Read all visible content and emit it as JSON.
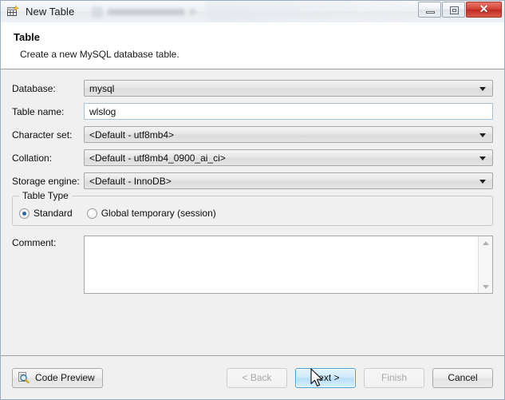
{
  "window": {
    "title": "New Table",
    "icon": "new-table-icon",
    "controls": {
      "minimize": "minimize-icon",
      "maximize": "restore-icon",
      "close": "✕"
    }
  },
  "header": {
    "title": "Table",
    "subtitle": "Create a new MySQL database table."
  },
  "form": {
    "database": {
      "label": "Database:",
      "value": "mysql",
      "type": "combobox"
    },
    "table_name": {
      "label": "Table name:",
      "value": "wlslog",
      "placeholder": "",
      "type": "text"
    },
    "character_set": {
      "label": "Character set:",
      "value": "<Default - utf8mb4>",
      "type": "combobox"
    },
    "collation": {
      "label": "Collation:",
      "value": "<Default - utf8mb4_0900_ai_ci>",
      "type": "combobox"
    },
    "storage_engine": {
      "label": "Storage engine:",
      "value": "<Default - InnoDB>",
      "type": "combobox"
    },
    "table_type": {
      "legend": "Table Type",
      "options": [
        {
          "label": "Standard",
          "selected": true
        },
        {
          "label": "Global temporary (session)",
          "selected": false
        }
      ]
    },
    "comment": {
      "label": "Comment:",
      "value": "",
      "placeholder": ""
    }
  },
  "footer": {
    "code_preview": "Code Preview",
    "back": "< Back",
    "next": "Next >",
    "finish": "Finish",
    "cancel": "Cancel"
  },
  "colors": {
    "accent": "#2567a8",
    "primary_button_border": "#4d9ed0",
    "close_button": "#c0392b",
    "dialog_background": "#f0f0f0"
  }
}
